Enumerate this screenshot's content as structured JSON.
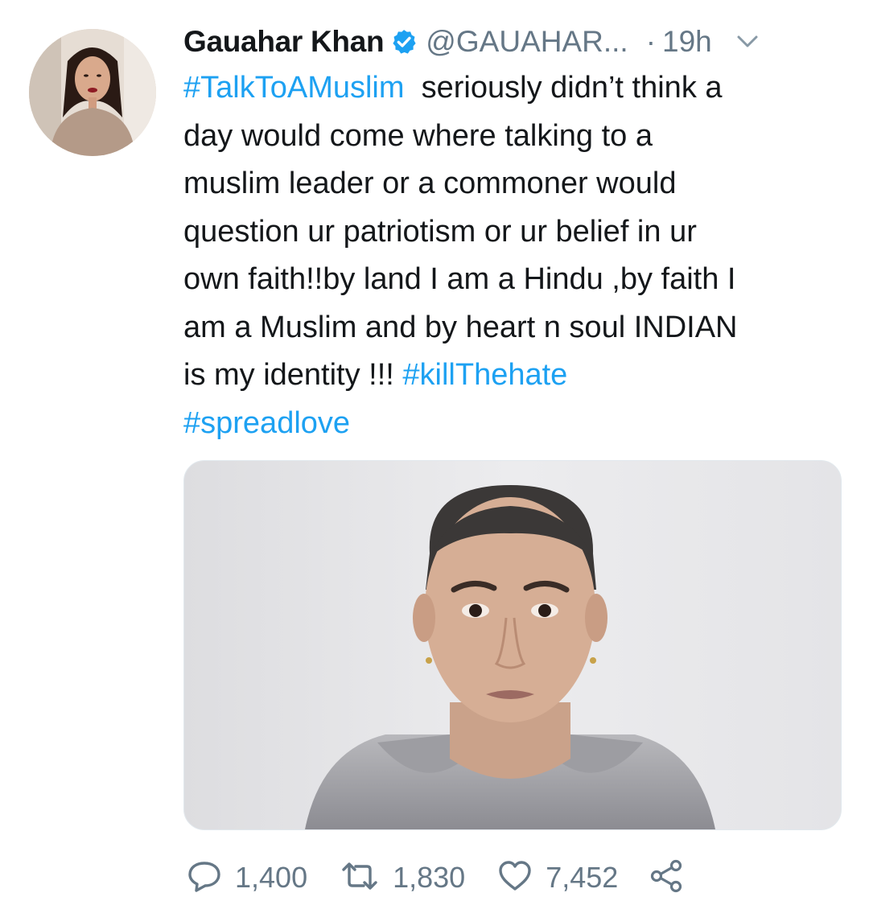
{
  "tweet": {
    "author": {
      "name": "Gauahar Khan",
      "handle": "@GAUAHAR...",
      "verified_icon": "verified-badge-icon"
    },
    "separator": "·",
    "time": "19h",
    "text_lines": [
      [
        {
          "t": "#TalkToAMuslim",
          "tag": true
        },
        {
          "t": "  seriously didn’t think a",
          "tag": false
        }
      ],
      [
        {
          "t": "day would come where talking to a",
          "tag": false
        }
      ],
      [
        {
          "t": "muslim leader or a commoner would",
          "tag": false
        }
      ],
      [
        {
          "t": "question ur patriotism or ur belief in ur",
          "tag": false
        }
      ],
      [
        {
          "t": "own faith!!by land I am a Hindu ,by faith I",
          "tag": false
        }
      ],
      [
        {
          "t": "am a Muslim and by heart n soul INDIAN",
          "tag": false
        }
      ],
      [
        {
          "t": "is my identity !!! ",
          "tag": false
        },
        {
          "t": "#killThehate",
          "tag": true
        }
      ],
      [
        {
          "t": "#spreadlove",
          "tag": true
        }
      ]
    ],
    "actions": {
      "replies": "1,400",
      "retweets": "1,830",
      "likes": "7,452"
    }
  },
  "colors": {
    "link": "#1da1f2",
    "text": "#14171a",
    "muted": "#657786",
    "verified": "#1da1f2"
  }
}
